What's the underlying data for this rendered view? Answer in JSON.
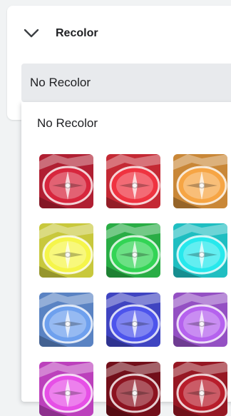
{
  "header": {
    "title": "Recolor"
  },
  "select": {
    "value": "No Recolor"
  },
  "dropdown": {
    "option_label": "No Recolor"
  },
  "swatches": [
    {
      "name": "red-dark",
      "color": "#d7263d"
    },
    {
      "name": "red",
      "color": "#ef3340"
    },
    {
      "name": "orange",
      "color": "#f6a544"
    },
    {
      "name": "yellow",
      "color": "#f5f54a"
    },
    {
      "name": "green",
      "color": "#33d455"
    },
    {
      "name": "cyan",
      "color": "#27e8ec"
    },
    {
      "name": "blue-light",
      "color": "#6ea0ee"
    },
    {
      "name": "blue",
      "color": "#4d54ec"
    },
    {
      "name": "purple",
      "color": "#b562ee"
    },
    {
      "name": "magenta",
      "color": "#e64fe6"
    },
    {
      "name": "maroon",
      "color": "#8c1320"
    },
    {
      "name": "crimson",
      "color": "#b81d2b"
    }
  ]
}
